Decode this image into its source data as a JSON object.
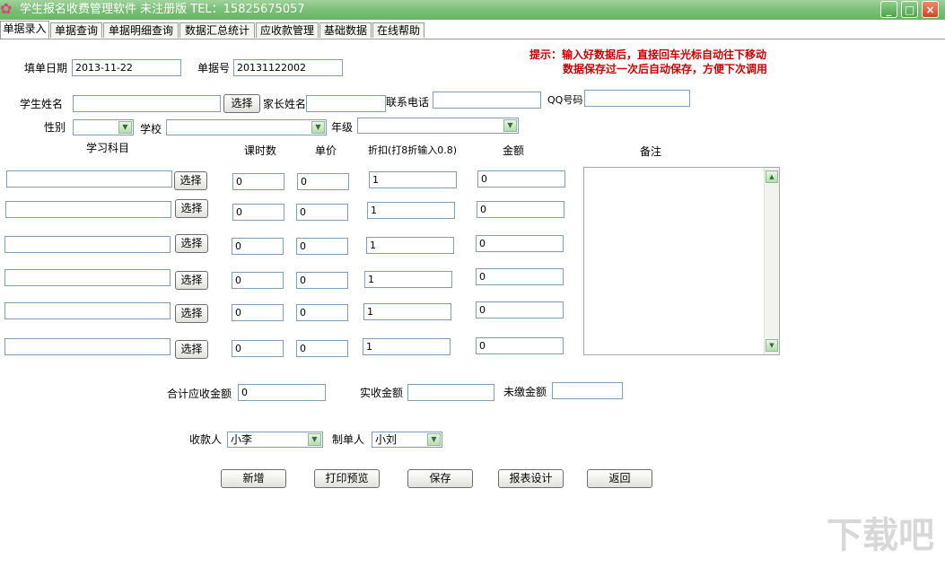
{
  "window": {
    "title": "学生报名收费管理软件 未注册版  TEL：15825675057",
    "controls": {
      "minimize": "_",
      "maximize": "□",
      "close": "×"
    }
  },
  "tabs": [
    "单据录入",
    "单据查询",
    "单据明细查询",
    "数据汇总统计",
    "应收款管理",
    "基础数据",
    "在线帮助"
  ],
  "hint": {
    "line1": "提示：输入好数据后，直接回车光标自动往下移动",
    "line2": "数据保存过一次后自动保存，方便下次调用"
  },
  "form": {
    "date_label": "填单日期",
    "date_value": "2013-11-22",
    "doc_no_label": "单据号",
    "doc_no_value": "20131122002",
    "student_label": "学生姓名",
    "student_value": "",
    "select_label": "选择",
    "parent_label": "家长姓名",
    "parent_value": "",
    "phone_label": "联系电话",
    "phone_value": "",
    "qq_label": "QQ号码",
    "qq_value": "",
    "gender_label": "性别",
    "gender_value": "",
    "school_label": "学校",
    "school_value": "",
    "grade_label": "年级",
    "grade_value": ""
  },
  "table": {
    "headers": {
      "subject": "学习科目",
      "hours": "课时数",
      "price": "单价",
      "discount": "折扣(打8折输入0.8)",
      "amount": "金额",
      "remarks": "备注"
    },
    "rows": [
      {
        "subject": "",
        "select": "选择",
        "hours": "0",
        "price": "0",
        "discount": "1",
        "amount": "0"
      },
      {
        "subject": "",
        "select": "选择",
        "hours": "0",
        "price": "0",
        "discount": "1",
        "amount": "0"
      },
      {
        "subject": "",
        "select": "选择",
        "hours": "0",
        "price": "0",
        "discount": "1",
        "amount": "0"
      },
      {
        "subject": "",
        "select": "选择",
        "hours": "0",
        "price": "0",
        "discount": "1",
        "amount": "0"
      },
      {
        "subject": "",
        "select": "选择",
        "hours": "0",
        "price": "0",
        "discount": "1",
        "amount": "0"
      },
      {
        "subject": "",
        "select": "选择",
        "hours": "0",
        "price": "0",
        "discount": "1",
        "amount": "0"
      }
    ],
    "remarks_value": ""
  },
  "totals": {
    "receivable_label": "合计应收金额",
    "receivable_value": "0",
    "received_label": "实收金额",
    "received_value": "",
    "unpaid_label": "未缴金额",
    "unpaid_value": ""
  },
  "people": {
    "collector_label": "收款人",
    "collector_value": "小李",
    "maker_label": "制单人",
    "maker_value": "小刘"
  },
  "actions": {
    "add": "新增",
    "print_preview": "打印预览",
    "save": "保存",
    "report_design": "报表设计",
    "back": "返回"
  },
  "icons": {
    "app": "flower-icon",
    "dropdown": "chevron-down-icon",
    "scroll_up": "arrow-up-icon",
    "scroll_down": "arrow-down-icon"
  },
  "colors": {
    "titlebar": "#7cc179",
    "hint": "#cc0000",
    "input_border": "#7f9db9"
  },
  "watermark": "下载吧"
}
